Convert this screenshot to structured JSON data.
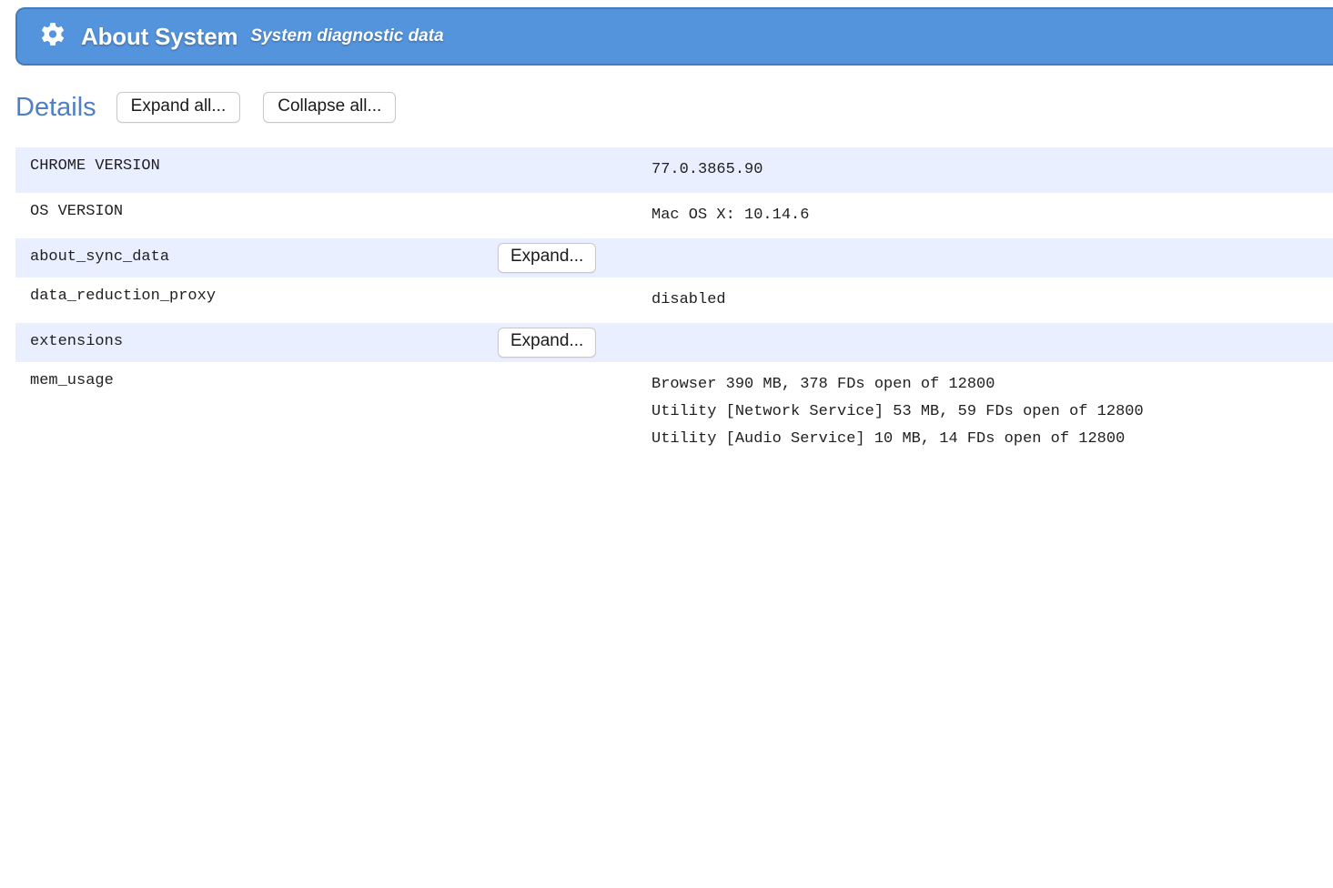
{
  "banner": {
    "icon": "gear-icon",
    "title": "About System",
    "subtitle": "System diagnostic data",
    "background_color": "#5494dc",
    "border_color": "#3f7cbf",
    "text_color": "#ffffff"
  },
  "toolbar": {
    "heading": "Details",
    "heading_color": "#4d7fc4",
    "expand_all_label": "Expand all...",
    "collapse_all_label": "Collapse all..."
  },
  "table": {
    "stripe_color": "#eaefff",
    "divider_color": "#b9c4d6",
    "rows": [
      {
        "label": "CHROME VERSION",
        "action": "",
        "value": "77.0.3865.90",
        "striped": true
      },
      {
        "label": "OS VERSION",
        "action": "",
        "value": "Mac OS X: 10.14.6",
        "striped": false
      },
      {
        "label": "about_sync_data",
        "action": "Expand...",
        "value": "",
        "striped": true
      },
      {
        "label": "data_reduction_proxy",
        "action": "",
        "value": "disabled",
        "striped": false
      },
      {
        "label": "extensions",
        "action": "Expand...",
        "value": "",
        "striped": true
      },
      {
        "label": "mem_usage",
        "action": "",
        "value": "Browser 390 MB, 378 FDs open of 12800\nUtility [Network Service] 53 MB, 59 FDs open of 12800\nUtility [Audio Service] 10 MB, 14 FDs open of 12800",
        "striped": false
      }
    ]
  }
}
